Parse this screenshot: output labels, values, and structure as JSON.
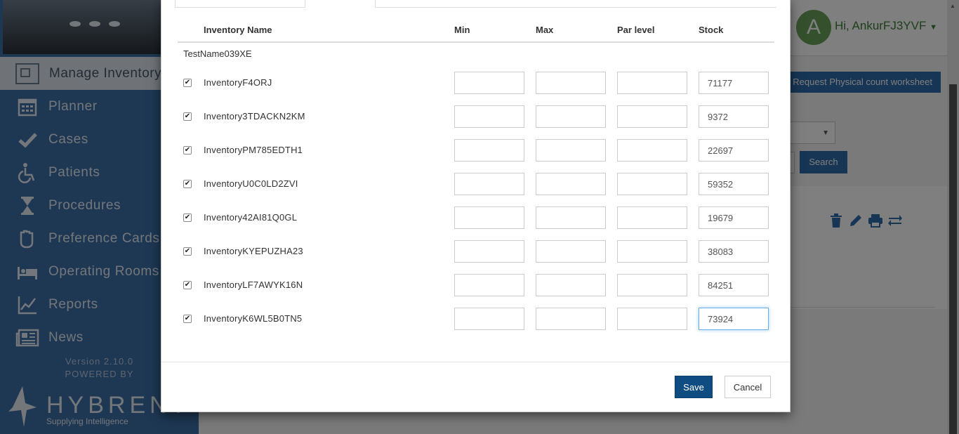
{
  "sidebar": {
    "manage_label": "Manage Inventory",
    "nav": [
      {
        "label": "Planner",
        "icon": "calendar-icon"
      },
      {
        "label": "Cases",
        "icon": "checkmark-icon"
      },
      {
        "label": "Patients",
        "icon": "wheelchair-icon"
      },
      {
        "label": "Procedures",
        "icon": "hourglass-icon"
      },
      {
        "label": "Preference Cards",
        "icon": "hand-icon"
      },
      {
        "label": "Operating Rooms",
        "icon": "bed-icon"
      },
      {
        "label": "Reports",
        "icon": "line-chart-icon"
      },
      {
        "label": "News",
        "icon": "newspaper-icon"
      }
    ],
    "version": "Version 2.10.0",
    "powered_by": "POWERED BY",
    "logo_word": "HYBRENT",
    "logo_tagline": "Supplying Intelligence"
  },
  "header": {
    "avatar_letter": "A",
    "greeting": "Hi, AnkurFJ3YVF",
    "request_button": "Request Physical count worksheet",
    "search_button": "Search"
  },
  "modal": {
    "columns": {
      "name": "Inventory Name",
      "min": "Min",
      "max": "Max",
      "par": "Par level",
      "stock": "Stock"
    },
    "group": "TestName039XE",
    "rows": [
      {
        "name": "InventoryF4ORJ",
        "checked": true,
        "min": "",
        "max": "",
        "par": "",
        "stock": "71177"
      },
      {
        "name": "Inventory3TDACKN2KM",
        "checked": true,
        "min": "",
        "max": "",
        "par": "",
        "stock": "9372"
      },
      {
        "name": "InventoryPM785EDTH1",
        "checked": true,
        "min": "",
        "max": "",
        "par": "",
        "stock": "22697"
      },
      {
        "name": "InventoryU0C0LD2ZVI",
        "checked": true,
        "min": "",
        "max": "",
        "par": "",
        "stock": "59352"
      },
      {
        "name": "Inventory42AI81Q0GL",
        "checked": true,
        "min": "",
        "max": "",
        "par": "",
        "stock": "19679"
      },
      {
        "name": "InventoryKYEPUZHA23",
        "checked": true,
        "min": "",
        "max": "",
        "par": "",
        "stock": "38083"
      },
      {
        "name": "InventoryLF7AWYK16N",
        "checked": true,
        "min": "",
        "max": "",
        "par": "",
        "stock": "84251"
      },
      {
        "name": "InventoryK6WL5B0TN5",
        "checked": true,
        "min": "",
        "max": "",
        "par": "",
        "stock": "73924"
      }
    ],
    "save_label": "Save",
    "cancel_label": "Cancel"
  },
  "colors": {
    "sidebar": "#3d6fa6",
    "primary_button": "#0f4c81",
    "accent_blue": "#2f6aa9",
    "greeting_green": "#3b7f35"
  }
}
